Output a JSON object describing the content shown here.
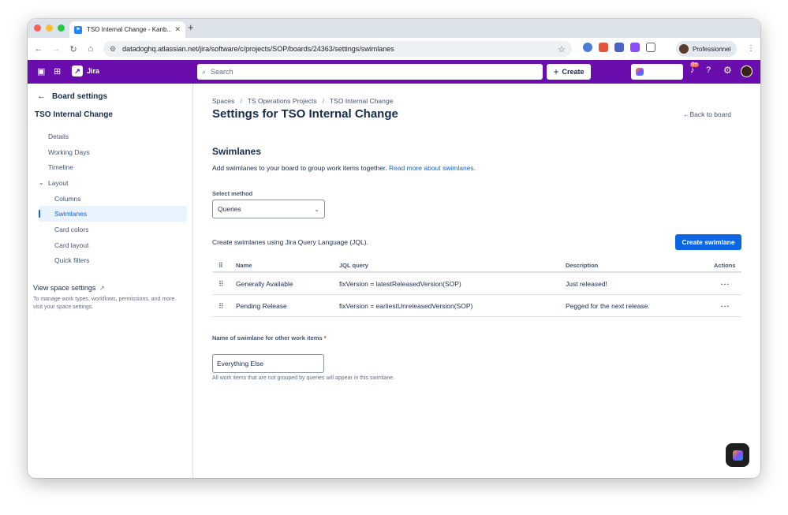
{
  "browser": {
    "tab_title": "TSO Internal Change - Kanb...",
    "tab_close": "✕",
    "new_tab": "+",
    "url": "datadoghq.atlassian.net/jira/software/c/projects/SOP/boards/24363/settings/swimlanes",
    "profile_name": "Professionnel"
  },
  "topnav": {
    "app_name": "Jira",
    "search_placeholder": "Search",
    "create_label": "Create",
    "notification_badge": "9+"
  },
  "sidebar": {
    "back_label": "Board settings",
    "project_name": "TSO Internal Change",
    "items": [
      {
        "label": "Details"
      },
      {
        "label": "Working Days"
      },
      {
        "label": "Timeline"
      },
      {
        "label": "Layout"
      },
      {
        "label": "Columns"
      },
      {
        "label": "Swimlanes"
      },
      {
        "label": "Card colors"
      },
      {
        "label": "Card layout"
      },
      {
        "label": "Quick filters"
      }
    ],
    "active_item": "Swimlanes",
    "space_settings_label": "View space settings",
    "space_settings_desc": "To manage work types, workflows, permissions, and more visit your space settings."
  },
  "main": {
    "breadcrumbs": [
      "Spaces",
      "TS Operations Projects",
      "TSO Internal Change"
    ],
    "title": "Settings for TSO Internal Change",
    "back_to_board": "←Back to board",
    "section_title": "Swimlanes",
    "intro_text": "Add swimlanes to your board to group work items together. ",
    "intro_link": "Read more about swimlanes.",
    "select_method_label": "Select method",
    "select_method_value": "Queries",
    "jql_description": "Create swimlanes using Jira Query Language (JQL).",
    "create_swimlane_label": "Create swimlane",
    "table": {
      "headers": {
        "name": "Name",
        "jql": "JQL query",
        "description": "Description",
        "actions": "Actions"
      },
      "rows": [
        {
          "name": "Generally Available",
          "jql": "fixVersion = latestReleasedVersion(SOP)",
          "description": "Just released!"
        },
        {
          "name": "Pending Release",
          "jql": "fixVersion = earliestUnreleasedVersion(SOP)",
          "description": "Pegged for the next release."
        }
      ]
    },
    "other_swimlane_label": "Name of swimlane for other work items",
    "other_swimlane_required": "*",
    "other_swimlane_value": "Everything Else",
    "other_swimlane_help": "All work items that are not grouped by queries will appear in this swimlane."
  },
  "colors": {
    "topnav_bg": "#6a0dad",
    "primary": "#0c66e4",
    "active_bg": "#e9f2ff"
  }
}
